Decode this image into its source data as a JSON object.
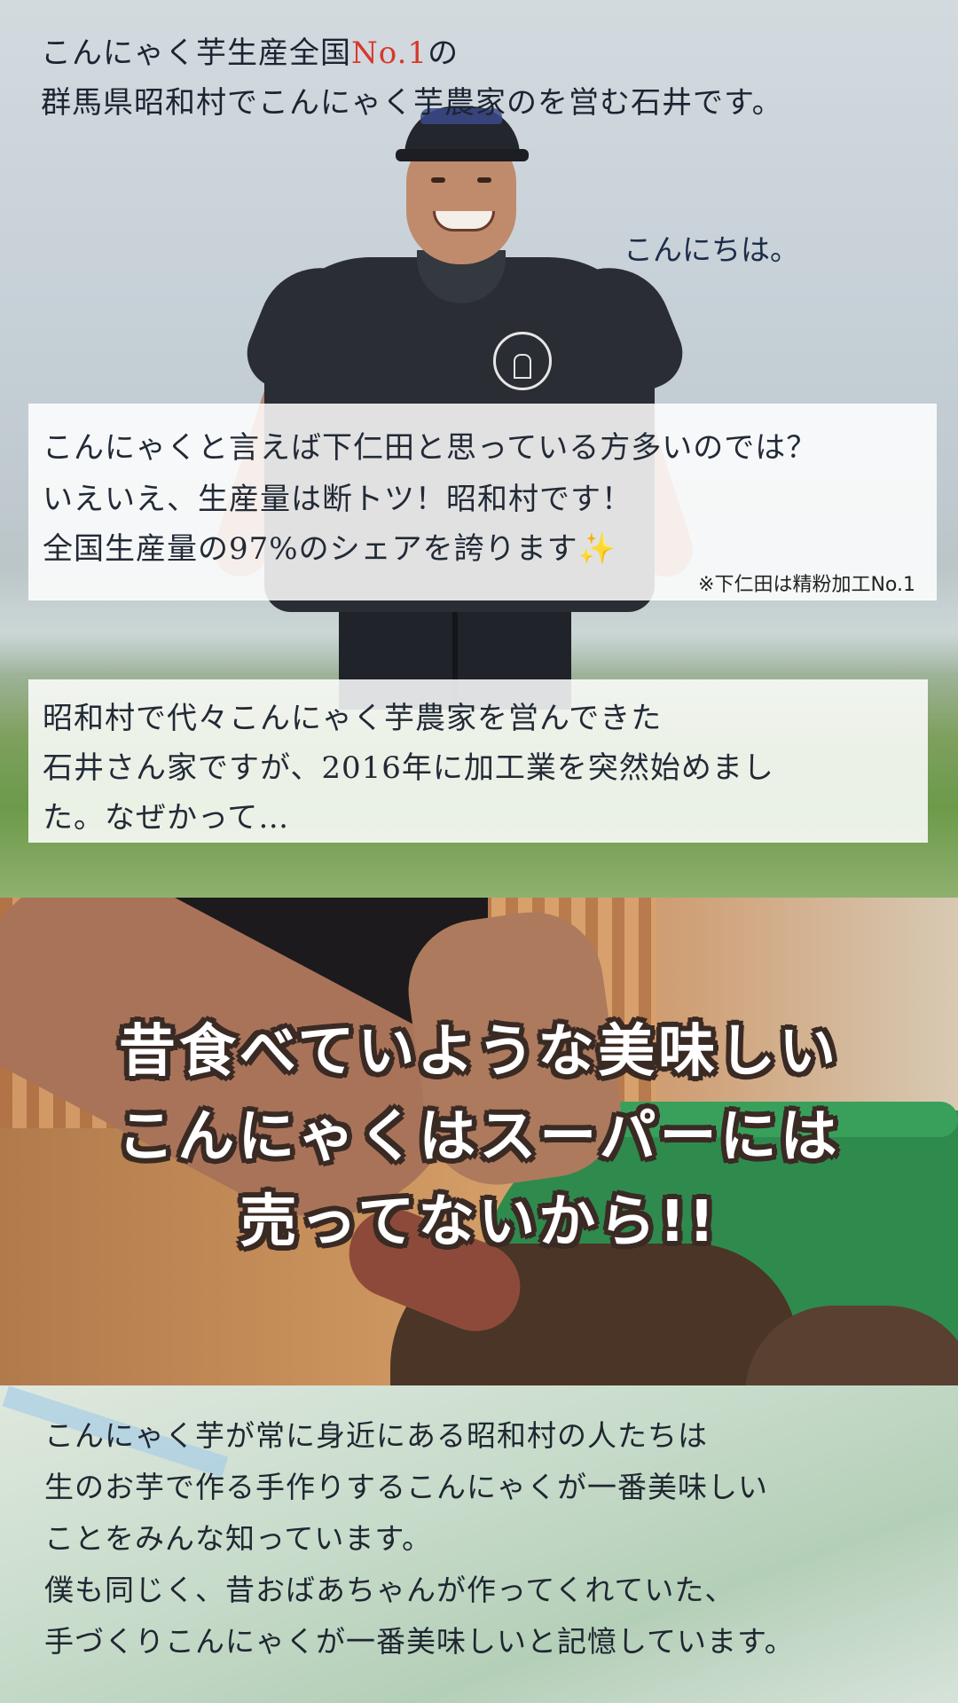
{
  "hero": {
    "line1_pre": "こんにゃく芋生産全国",
    "line1_accent": "No.1",
    "line1_post": "の",
    "line2": "群馬県昭和村でこんにゃく芋農家のを営む石井です。",
    "greeting": "こんにちは。",
    "accent_color": "#d9382d"
  },
  "card1": {
    "line1": "こんにゃくと言えば下仁田と思っている方多いのでは？",
    "line2": "いえいえ、生産量は断トツ！昭和村です！",
    "line3": "全国生産量の97%のシェアを誇ります",
    "sparkle": "✨",
    "note": "※下仁田は精粉加工No.1"
  },
  "card2": {
    "line1": "昭和村で代々こんにゃく芋農家を営んできた",
    "line2": "石井さん家ですが、2016年に加工業を突然始めまし",
    "line3": "た。なぜかって…"
  },
  "headline": {
    "line1": "昔食べていような美味しい",
    "line2": "こんにゃくはスーパーには",
    "line3": "売ってないから!!"
  },
  "bottom": {
    "line1": "こんにゃく芋が常に身近にある昭和村の人たちは",
    "line2": "生のお芋で作る手作りするこんにゃくが一番美味しい",
    "line3": "ことをみんな知っています。",
    "line4": "僕も同じく、昔おばあちゃんが作ってくれていた、",
    "line5": "手づくりこんにゃくが一番美味しいと記憶しています。"
  }
}
